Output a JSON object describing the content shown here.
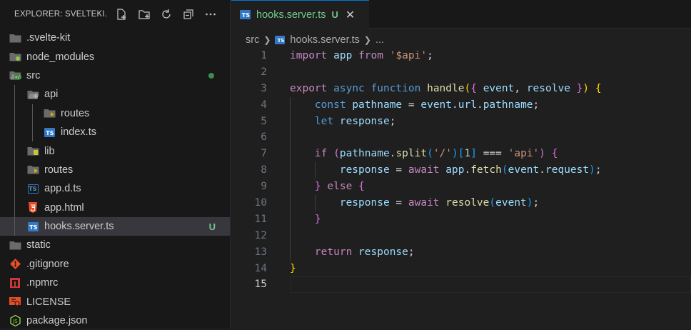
{
  "explorer": {
    "title": "EXPLORER: SVELTEKI...",
    "actions": [
      "new-file-icon",
      "new-folder-icon",
      "refresh-icon",
      "collapse-all-icon",
      "more-icon"
    ],
    "items": [
      {
        "label": ".svelte-kit",
        "depth": 0,
        "kind": "folder",
        "icon": "folder-icon"
      },
      {
        "label": "node_modules",
        "depth": 0,
        "kind": "folder",
        "icon": "node-folder-icon"
      },
      {
        "label": "src",
        "depth": 0,
        "kind": "folder-open",
        "icon": "src-folder-icon",
        "modified_dot": true
      },
      {
        "label": "api",
        "depth": 1,
        "kind": "folder-open",
        "icon": "api-folder-icon"
      },
      {
        "label": "routes",
        "depth": 2,
        "kind": "folder",
        "icon": "routes-folder-icon"
      },
      {
        "label": "index.ts",
        "depth": 2,
        "kind": "ts",
        "icon": "typescript-icon"
      },
      {
        "label": "lib",
        "depth": 1,
        "kind": "folder",
        "icon": "lib-folder-icon"
      },
      {
        "label": "routes",
        "depth": 1,
        "kind": "folder",
        "icon": "routes-folder-icon"
      },
      {
        "label": "app.d.ts",
        "depth": 1,
        "kind": "dts",
        "icon": "typescript-def-icon"
      },
      {
        "label": "app.html",
        "depth": 1,
        "kind": "html",
        "icon": "html-icon"
      },
      {
        "label": "hooks.server.ts",
        "depth": 1,
        "kind": "ts",
        "icon": "typescript-icon",
        "selected": true,
        "badge": "U"
      },
      {
        "label": "static",
        "depth": 0,
        "kind": "folder",
        "icon": "folder-icon"
      },
      {
        "label": ".gitignore",
        "depth": 0,
        "kind": "git",
        "icon": "git-icon"
      },
      {
        "label": ".npmrc",
        "depth": 0,
        "kind": "npm",
        "icon": "npm-icon"
      },
      {
        "label": "LICENSE",
        "depth": 0,
        "kind": "license",
        "icon": "license-icon"
      },
      {
        "label": "package.json",
        "depth": 0,
        "kind": "node",
        "icon": "nodejs-icon"
      }
    ]
  },
  "tab": {
    "label": "hooks.server.ts",
    "status": "U",
    "close": "✕"
  },
  "breadcrumb": {
    "folder": "src",
    "file": "hooks.server.ts",
    "more": "..."
  },
  "editor": {
    "current_line": 15,
    "lines": [
      {
        "n": "1",
        "tokens": [
          [
            "import",
            "k1"
          ],
          [
            " ",
            ""
          ],
          [
            "app",
            "v"
          ],
          [
            " ",
            ""
          ],
          [
            "from",
            "k1"
          ],
          [
            " ",
            ""
          ],
          [
            "'$api'",
            "st"
          ],
          [
            ";",
            "p"
          ]
        ]
      },
      {
        "n": "2",
        "tokens": []
      },
      {
        "n": "3",
        "tokens": [
          [
            "export",
            "k1"
          ],
          [
            " ",
            ""
          ],
          [
            "async",
            "k2"
          ],
          [
            " ",
            ""
          ],
          [
            "function",
            "k2"
          ],
          [
            " ",
            ""
          ],
          [
            "handle",
            "fn"
          ],
          [
            "(",
            "b1"
          ],
          [
            "{",
            "b2"
          ],
          [
            " ",
            ""
          ],
          [
            "event",
            "v"
          ],
          [
            ", ",
            "p"
          ],
          [
            "resolve",
            "v"
          ],
          [
            " ",
            ""
          ],
          [
            "}",
            "b2"
          ],
          [
            ")",
            "b1"
          ],
          [
            " ",
            ""
          ],
          [
            "{",
            "b1"
          ]
        ]
      },
      {
        "n": "4",
        "indent": 1,
        "tokens": [
          [
            "const",
            "k2"
          ],
          [
            " ",
            ""
          ],
          [
            "pathname",
            "v"
          ],
          [
            " = ",
            "p"
          ],
          [
            "event",
            "v"
          ],
          [
            ".",
            "p"
          ],
          [
            "url",
            "v"
          ],
          [
            ".",
            "p"
          ],
          [
            "pathname",
            "v"
          ],
          [
            ";",
            "p"
          ]
        ]
      },
      {
        "n": "5",
        "indent": 1,
        "tokens": [
          [
            "let",
            "k2"
          ],
          [
            " ",
            ""
          ],
          [
            "response",
            "v"
          ],
          [
            ";",
            "p"
          ]
        ]
      },
      {
        "n": "6",
        "tokens": []
      },
      {
        "n": "7",
        "indent": 1,
        "tokens": [
          [
            "if",
            "k1"
          ],
          [
            " ",
            ""
          ],
          [
            "(",
            "b2"
          ],
          [
            "pathname",
            "v"
          ],
          [
            ".",
            "p"
          ],
          [
            "split",
            "fn"
          ],
          [
            "(",
            "b3"
          ],
          [
            "'/'",
            "st"
          ],
          [
            ")",
            "b3"
          ],
          [
            "[",
            "b3"
          ],
          [
            "1",
            "nu"
          ],
          [
            "]",
            "b3"
          ],
          [
            " === ",
            "p"
          ],
          [
            "'api'",
            "st"
          ],
          [
            ")",
            "b2"
          ],
          [
            " ",
            ""
          ],
          [
            "{",
            "b2"
          ]
        ]
      },
      {
        "n": "8",
        "indent": 2,
        "tokens": [
          [
            "response",
            "v"
          ],
          [
            " = ",
            "p"
          ],
          [
            "await",
            "k1"
          ],
          [
            " ",
            ""
          ],
          [
            "app",
            "v"
          ],
          [
            ".",
            "p"
          ],
          [
            "fetch",
            "fn"
          ],
          [
            "(",
            "b3"
          ],
          [
            "event",
            "v"
          ],
          [
            ".",
            "p"
          ],
          [
            "request",
            "v"
          ],
          [
            ")",
            "b3"
          ],
          [
            ";",
            "p"
          ]
        ]
      },
      {
        "n": "9",
        "indent": 1,
        "tokens": [
          [
            "}",
            "b2"
          ],
          [
            " ",
            ""
          ],
          [
            "else",
            "k1"
          ],
          [
            " ",
            ""
          ],
          [
            "{",
            "b2"
          ]
        ]
      },
      {
        "n": "10",
        "indent": 2,
        "tokens": [
          [
            "response",
            "v"
          ],
          [
            " = ",
            "p"
          ],
          [
            "await",
            "k1"
          ],
          [
            " ",
            ""
          ],
          [
            "resolve",
            "fn"
          ],
          [
            "(",
            "b3"
          ],
          [
            "event",
            "v"
          ],
          [
            ")",
            "b3"
          ],
          [
            ";",
            "p"
          ]
        ]
      },
      {
        "n": "11",
        "indent": 1,
        "tokens": [
          [
            "}",
            "b2"
          ]
        ]
      },
      {
        "n": "12",
        "tokens": []
      },
      {
        "n": "13",
        "indent": 1,
        "tokens": [
          [
            "return",
            "k1"
          ],
          [
            " ",
            ""
          ],
          [
            "response",
            "v"
          ],
          [
            ";",
            "p"
          ]
        ]
      },
      {
        "n": "14",
        "tokens": [
          [
            "}",
            "b1"
          ]
        ]
      },
      {
        "n": "15",
        "tokens": []
      }
    ]
  }
}
